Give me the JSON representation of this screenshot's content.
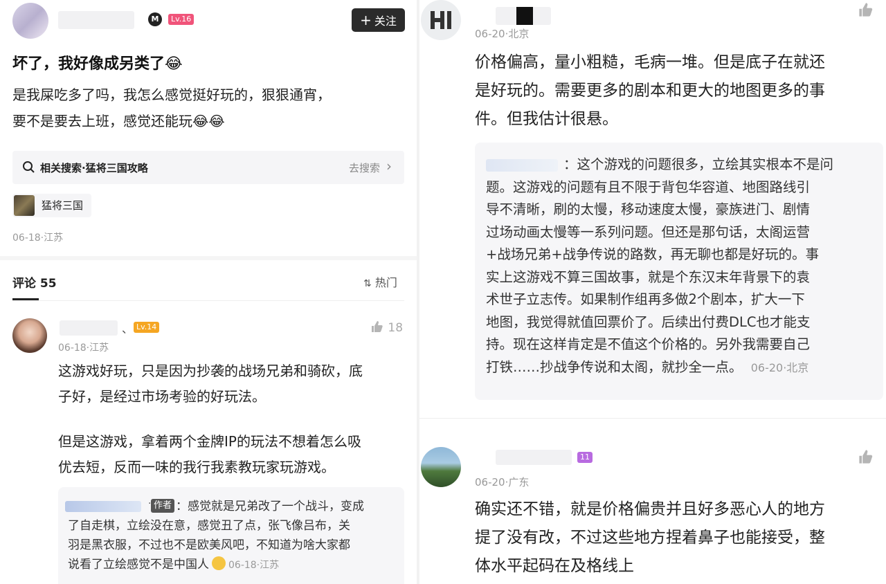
{
  "left": {
    "author": {
      "level": "Lv.16",
      "follow_label": "关注",
      "follow_plus": "+"
    },
    "post": {
      "title": "坏了，我好像成另类了😂",
      "body_line1": "是我屎吃多了吗，我怎么感觉挺好玩的，狠狠通宵，",
      "body_line2": "要不是要去上班，感觉还能玩😂😂",
      "search_label": "相关搜索·猛将三国攻略",
      "search_action": "去搜索",
      "game_tag": "猛将三国",
      "meta": "06-18·江苏"
    },
    "comments_header": {
      "label": "评论 55",
      "sort_label": "热门"
    },
    "comment1": {
      "level": "Lv.14",
      "meta": "06-18·江苏",
      "likes": "18",
      "line1": "这游戏好玩，只是因为抄袭的战场兄弟和骑砍，底",
      "line2": "子好，是经过市场考验的好玩法。",
      "line3": "但是这游戏，拿着两个金牌IP的玩法不想着怎么吸",
      "line4": "优去短，反而一味的我行我素教玩家玩游戏。",
      "reply": {
        "author_badge": "作者",
        "line1": "：感觉就是兄弟改了一个战斗，变成",
        "line2": "了自走棋，立绘没在意，感觉丑了点，张飞像吕布，关",
        "line3": "羽是黑衣服，不过也不是欧美风吧，不知道为啥大家都",
        "line4": "说看了立绘感觉不是中国人",
        "meta": "06-18·江苏"
      }
    }
  },
  "right": {
    "comment_a": {
      "meta": "06-20·北京",
      "line1": "价格偏高，量小粗糙，毛病一堆。但是底子在就还",
      "line2": "是好玩的。需要更多的剧本和更大的地图更多的事",
      "line3": "件。但我估计很悬。",
      "reply": {
        "lines": [
          "：这个游戏的问题很多，立绘其实根本不是问",
          "题。这游戏的问题有且不限于背包华容道、地图路线引",
          "导不清晰，刷的太慢，移动速度太慢，豪族进门、剧情",
          "过场动画太慢等一系列问题。但还是那句话，太阁运营",
          "+战场兄弟+战争传说的路数，再无聊也都是好玩的。事",
          "实上这游戏不算三国故事，就是个东汉末年背景下的袁",
          "术世子立志传。如果制作组再多做2个剧本，扩大一下",
          "地图，我觉得就值回票价了。后续出付费DLC也才能支",
          "持。现在这样肯定是不值这个价格的。另外我需要自己",
          "打铁……抄战争传说和太阁，就抄全一点。"
        ],
        "meta": "06-20·北京"
      }
    },
    "comment_b": {
      "level": "11",
      "meta": "06-20·广东",
      "line1": "确实还不错，就是价格偏贵并且好多恶心人的地方",
      "line2": "提了没有改，不过这些地方捏着鼻子也能接受，整",
      "line3": "体水平起码在及格线上"
    }
  },
  "colors": {
    "level_pink": "#f0547a",
    "level_orange": "#f5a623",
    "level_purple": "#b86be0",
    "dark_button": "#2b2b2b"
  }
}
